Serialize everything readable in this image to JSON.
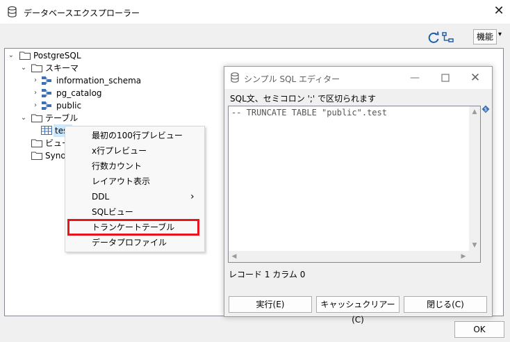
{
  "main_window": {
    "title": "データベースエクスプローラー",
    "close_glyph": "✕",
    "function_button": "機能",
    "function_arrow": "▾",
    "ok_button": "OK"
  },
  "tree": {
    "root": "PostgreSQL",
    "schemas_folder": "スキーマ",
    "schemas": [
      "information_schema",
      "pg_catalog",
      "public"
    ],
    "tables_folder": "テーブル",
    "table_item": "test",
    "views_folder": "ビュー",
    "synonyms_folder": "Synor"
  },
  "context_menu": {
    "items": [
      "最初の100行プレビュー",
      "x行プレビュー",
      "行数カウント",
      "レイアウト表示",
      "DDL",
      "SQLビュー",
      "トランケートテーブル",
      "データプロファイル"
    ],
    "submenu_arrow": "›",
    "highlighted_item": "トランケートテーブル",
    "highlight_color": "#e8141c"
  },
  "sql_dialog": {
    "title": "シンプル SQL エディター",
    "min_glyph": "—",
    "close_glyph": "✕",
    "label": "SQL文、セミコロン ';' で区切られます",
    "sql_text": "-- TRUNCATE TABLE \"public\".test",
    "status": "レコード 1 カラム 0",
    "buttons": {
      "execute": "実行(E)",
      "cache_clear": "キャッシュクリアー(C)",
      "close": "閉じる(C)"
    }
  },
  "colors": {
    "folder_outline": "#4a4a4a",
    "schema_icon": "#3d6fb6",
    "accent_blue": "#1f5fa8"
  }
}
